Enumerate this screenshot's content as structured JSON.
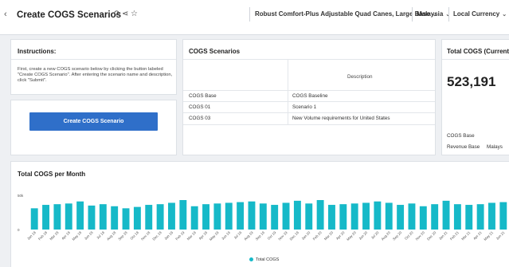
{
  "header": {
    "back_icon": "chevron-left-icon",
    "title": "Create COGS Scenarios",
    "icons": [
      "refresh-icon",
      "share-icon",
      "star-icon"
    ],
    "product_select": "Robust Comfort-Plus Adjustable Quad Canes, Large Base",
    "country_select": "Malaysia",
    "currency_select": "Local Currency"
  },
  "instructions": {
    "title": "Instructions:",
    "text": "First, create a new COGS scenario below by clicking the button labeled \"Create COGS Scenario\". After entering the scenario name and description, click \"Submit\".",
    "button_label": "Create COGS Scenario"
  },
  "scenarios": {
    "title": "COGS Scenarios",
    "column_header": "Description",
    "rows": [
      {
        "name": "COGS Base",
        "description": "COGS Baseline"
      },
      {
        "name": "COGS 01",
        "description": "Scenario 1"
      },
      {
        "name": "COGS 03",
        "description": "New Volume requirements for United States"
      }
    ]
  },
  "total": {
    "title": "Total COGS (Current Y...",
    "value": "523,191",
    "scenario_label": "COGS Base",
    "revenue_label": "Revenue Base",
    "revenue_country": "Malays"
  },
  "chart": {
    "title": "Total COGS per Month",
    "legend": "Total COGS",
    "color": "#16b9c8"
  },
  "chart_data": {
    "type": "bar",
    "title": "Total COGS per Month",
    "series": [
      {
        "name": "Total COGS"
      }
    ],
    "categories": [
      "Jan 18",
      "Feb 18",
      "Mar 18",
      "Apr 18",
      "May 18",
      "Jun 18",
      "Jul 18",
      "Aug 18",
      "Sep 18",
      "Oct 18",
      "Nov 18",
      "Dec 18",
      "Jan 19",
      "Feb 19",
      "Mar 19",
      "Apr 19",
      "May 19",
      "Jun 19",
      "Jul 19",
      "Aug 19",
      "Sep 19",
      "Oct 19",
      "Nov 19",
      "Dec 19",
      "Jan 20",
      "Feb 20",
      "Mar 20",
      "Apr 20",
      "May 20",
      "Jun 20",
      "Jul 20",
      "Aug 20",
      "Sep 20",
      "Oct 20",
      "Nov 20",
      "Dec 20",
      "Jan 21",
      "Feb 21",
      "Mar 21",
      "Apr 21",
      "May 21",
      "Jun 21"
    ],
    "values": [
      31000,
      36000,
      37000,
      38000,
      41000,
      35000,
      37000,
      34000,
      31000,
      33000,
      36000,
      37000,
      39000,
      43000,
      34000,
      37000,
      38000,
      39000,
      40000,
      41000,
      38000,
      36000,
      39000,
      42000,
      38000,
      43000,
      36000,
      37000,
      38000,
      39000,
      41000,
      39000,
      36000,
      38000,
      34000,
      37000,
      42000,
      37000,
      36000,
      37000,
      39000,
      40000
    ],
    "y_tick_labels": [
      "50k",
      "0"
    ],
    "ylim": [
      0,
      50000
    ]
  }
}
